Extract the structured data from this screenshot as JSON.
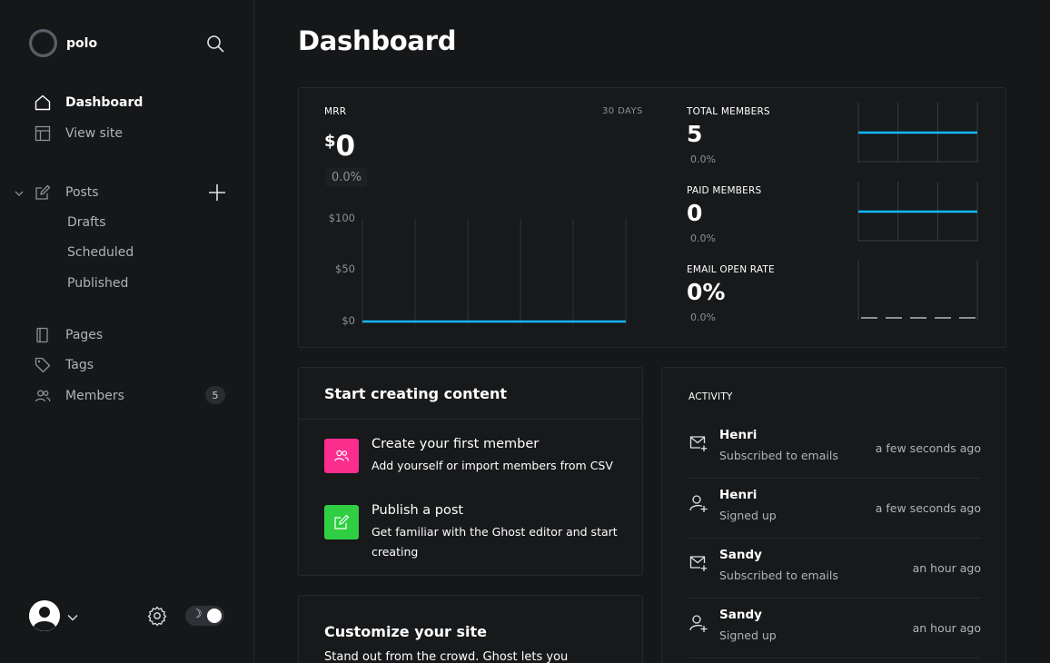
{
  "brand": {
    "name": "polo"
  },
  "nav": {
    "dashboard": "Dashboard",
    "view_site": "View site",
    "posts": "Posts",
    "drafts": "Drafts",
    "scheduled": "Scheduled",
    "published": "Published",
    "pages": "Pages",
    "tags": "Tags",
    "members": "Members",
    "members_count": "5"
  },
  "page": {
    "title": "Dashboard"
  },
  "metrics": {
    "mrr_label": "MRR",
    "mrr_range": "30 DAYS",
    "mrr_currency": "$",
    "mrr_value": "0",
    "mrr_change": "0.0%",
    "y_ticks": [
      "$100",
      "$50",
      "$0"
    ],
    "total_members": {
      "label": "TOTAL MEMBERS",
      "value": "5",
      "change": "0.0%"
    },
    "paid_members": {
      "label": "PAID MEMBERS",
      "value": "0",
      "change": "0.0%"
    },
    "email_open_rate": {
      "label": "EMAIL OPEN RATE",
      "value": "0%",
      "change": "0.0%"
    }
  },
  "chart_data": [
    {
      "type": "line",
      "title": "MRR",
      "ylim": [
        0,
        100
      ],
      "yticks": [
        "$100",
        "$50",
        "$0"
      ],
      "series": [
        {
          "values": [
            0,
            0,
            0,
            0,
            0,
            0
          ]
        }
      ]
    },
    {
      "type": "line",
      "title": "TOTAL MEMBERS",
      "series": [
        {
          "values": [
            5,
            5,
            5,
            5
          ]
        }
      ]
    },
    {
      "type": "line",
      "title": "PAID MEMBERS",
      "series": [
        {
          "values": [
            0,
            0,
            0,
            0
          ]
        }
      ]
    },
    {
      "type": "line",
      "title": "EMAIL OPEN RATE",
      "series": [
        {
          "values": [
            0,
            0,
            0,
            0,
            0
          ]
        }
      ]
    }
  ],
  "start": {
    "title": "Start creating content",
    "tasks": [
      {
        "title": "Create your first member",
        "desc": "Add yourself or import members from CSV"
      },
      {
        "title": "Publish a post",
        "desc": "Get familiar with the Ghost editor and start creating"
      }
    ]
  },
  "customize": {
    "title": "Customize your site",
    "desc": "Stand out from the crowd. Ghost lets you"
  },
  "activity": {
    "label": "ACTIVITY",
    "items": [
      {
        "name": "Henri",
        "desc": "Subscribed to emails",
        "time": "a few seconds ago",
        "icon": "mail-plus-icon"
      },
      {
        "name": "Henri",
        "desc": "Signed up",
        "time": "a few seconds ago",
        "icon": "user-plus-icon"
      },
      {
        "name": "Sandy",
        "desc": "Subscribed to emails",
        "time": "an hour ago",
        "icon": "mail-plus-icon"
      },
      {
        "name": "Sandy",
        "desc": "Signed up",
        "time": "an hour ago",
        "icon": "user-plus-icon"
      }
    ]
  },
  "colors": {
    "accent": "#14b8ff",
    "member_task": "#fb2d8d",
    "post_task": "#30cf43"
  }
}
